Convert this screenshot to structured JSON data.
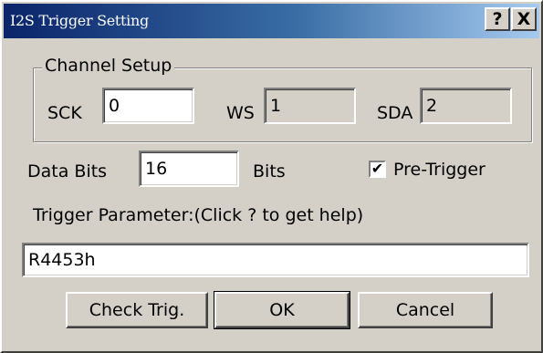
{
  "dialog": {
    "title": "I2S Trigger Setting",
    "help_button": "?",
    "close_button": "X"
  },
  "channel_setup": {
    "legend": "Channel Setup",
    "sck_label": "SCK",
    "sck_value": "0",
    "ws_label": "WS",
    "ws_value": "1",
    "sda_label": "SDA",
    "sda_value": "2"
  },
  "data_bits": {
    "label": "Data Bits",
    "value": "16",
    "unit": "Bits"
  },
  "pre_trigger": {
    "label": "Pre-Trigger",
    "checked": true,
    "check_mark": "✔"
  },
  "trigger_parameter": {
    "label": "Trigger Parameter:(Click ? to get help)",
    "value": "R4453h"
  },
  "buttons": {
    "check_trig": "Check Trig.",
    "ok": "OK",
    "cancel": "Cancel"
  },
  "colors": {
    "title_start": "#0a246a",
    "title_end": "#a6caf0",
    "face": "#d4d0c8"
  }
}
